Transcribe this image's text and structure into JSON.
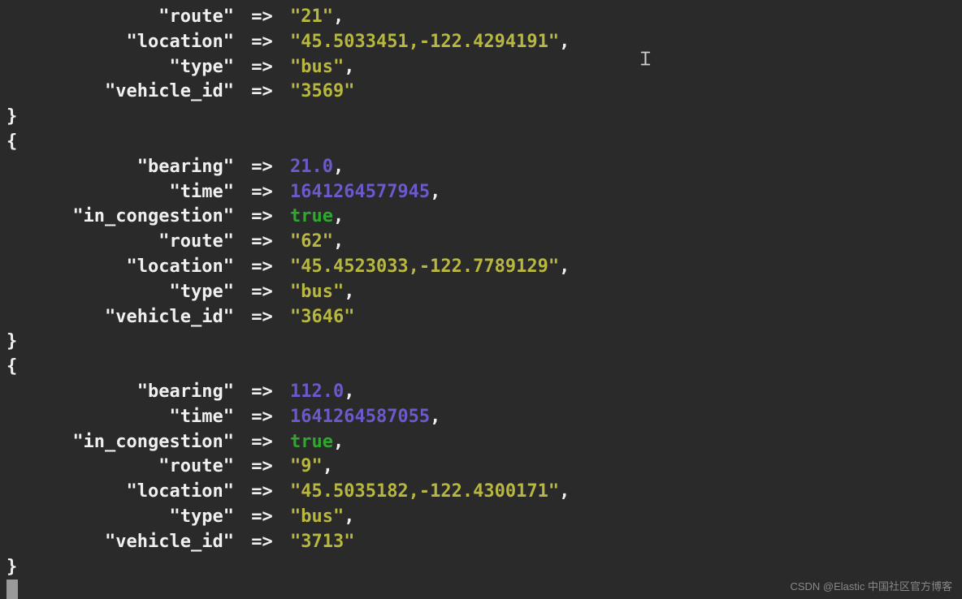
{
  "records": [
    {
      "partial": true,
      "fields": [
        {
          "key": "route",
          "value": "21",
          "type": "str",
          "comma": true
        },
        {
          "key": "location",
          "value": "45.5033451,-122.4294191",
          "type": "str",
          "comma": true
        },
        {
          "key": "type",
          "value": "bus",
          "type": "str",
          "comma": true
        },
        {
          "key": "vehicle_id",
          "value": "3569",
          "type": "str",
          "comma": false
        }
      ]
    },
    {
      "partial": false,
      "fields": [
        {
          "key": "bearing",
          "value": "21.0",
          "type": "num",
          "comma": true
        },
        {
          "key": "time",
          "value": "1641264577945",
          "type": "num",
          "comma": true
        },
        {
          "key": "in_congestion",
          "value": "true",
          "type": "bool",
          "comma": true
        },
        {
          "key": "route",
          "value": "62",
          "type": "str",
          "comma": true
        },
        {
          "key": "location",
          "value": "45.4523033,-122.7789129",
          "type": "str",
          "comma": true
        },
        {
          "key": "type",
          "value": "bus",
          "type": "str",
          "comma": true
        },
        {
          "key": "vehicle_id",
          "value": "3646",
          "type": "str",
          "comma": false
        }
      ]
    },
    {
      "partial": false,
      "fields": [
        {
          "key": "bearing",
          "value": "112.0",
          "type": "num",
          "comma": true
        },
        {
          "key": "time",
          "value": "1641264587055",
          "type": "num",
          "comma": true
        },
        {
          "key": "in_congestion",
          "value": "true",
          "type": "bool",
          "comma": true
        },
        {
          "key": "route",
          "value": "9",
          "type": "str",
          "comma": true
        },
        {
          "key": "location",
          "value": "45.5035182,-122.4300171",
          "type": "str",
          "comma": true
        },
        {
          "key": "type",
          "value": "bus",
          "type": "str",
          "comma": true
        },
        {
          "key": "vehicle_id",
          "value": "3713",
          "type": "str",
          "comma": false
        }
      ]
    }
  ],
  "arrow": "=>",
  "open_brace": "{",
  "close_brace": "}",
  "quote": "\"",
  "comma": ",",
  "watermark": "CSDN @Elastic 中国社区官方博客",
  "text_cursor_glyph": "𝙸"
}
